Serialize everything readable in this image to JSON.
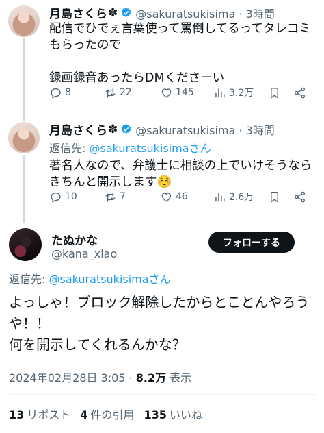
{
  "tweet1": {
    "name": "月島さくら",
    "name_symbol": "✽",
    "handle": "@sakuratsukisima · 3時間",
    "text": "配信でひでぇ言葉使って罵倒してるってタレコミもらったので\n\n録画録音あったらDMくださーい",
    "replies": "8",
    "retweets": "22",
    "likes": "145",
    "views": "3.2万"
  },
  "tweet2": {
    "name": "月島さくら",
    "name_symbol": "✽",
    "handle": "@sakuratsukisima · 3時間",
    "reply_prefix": "返信先: ",
    "reply_user": "@sakuratsukisimaさん",
    "text": "著名人なので、弁護士に相談の上でいけそうならきちんと開示します☺️",
    "replies": "10",
    "retweets": "7",
    "likes": "46",
    "views": "2.6万"
  },
  "main_tweet": {
    "name": "たぬかな",
    "handle": "@kana_xiao",
    "follow_label": "フォローする",
    "reply_prefix": "返信先: ",
    "reply_user": "@sakuratsukisimaさん",
    "text": "よっしゃ！ブロック解除したからとことんやろうや！！\n何を開示してくれるんかな？",
    "timestamp": "2024年02月28日 3:05 · ",
    "views_count": "8.2万",
    "views_label": " 表示",
    "stats": {
      "reposts_count": "13",
      "reposts_label": "リポスト",
      "quotes_count": "4",
      "quotes_label": "件の引用",
      "likes_count": "135",
      "likes_label": "いいね"
    }
  },
  "colors": {
    "verified": "#1d9bf0",
    "link": "#1d9bf0",
    "secondary_text": "#536471"
  },
  "icons": [
    "reply-icon",
    "retweet-icon",
    "like-icon",
    "views-icon",
    "bookmark-icon",
    "share-icon",
    "verified-icon"
  ]
}
